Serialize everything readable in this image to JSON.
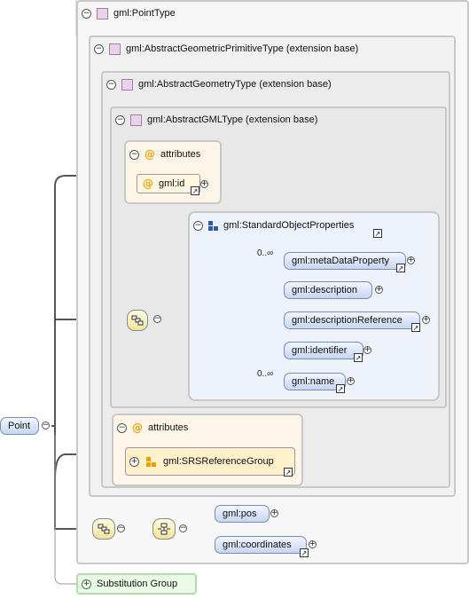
{
  "point": {
    "label": "Point"
  },
  "types": {
    "point_type": "gml:PointType",
    "abstract_geometric_primitive": "gml:AbstractGeometricPrimitiveType (extension base)",
    "abstract_geometry": "gml:AbstractGeometryType (extension base)",
    "abstract_gml": "gml:AbstractGMLType (extension base)"
  },
  "attributes_inner": {
    "label": "attributes",
    "items": [
      "gml:id"
    ]
  },
  "standard_object_properties": {
    "label": "gml:StandardObjectProperties",
    "elements": [
      {
        "name": "gml:metaDataProperty",
        "occurs": "0..∞"
      },
      {
        "name": "gml:description",
        "occurs": ""
      },
      {
        "name": "gml:descriptionReference",
        "occurs": ""
      },
      {
        "name": "gml:identifier",
        "occurs": ""
      },
      {
        "name": "gml:name",
        "occurs": "0..∞"
      }
    ]
  },
  "attributes_outer": {
    "label": "attributes",
    "items": [
      "gml:SRSReferenceGroup"
    ]
  },
  "choice": {
    "items": [
      "gml:pos",
      "gml:coordinates"
    ]
  },
  "substitution": {
    "label": "Substitution Group"
  },
  "colors": {
    "element_fill": "#c6d6f0",
    "attribute_fill": "#fdf6e8",
    "type_border": "#c8c8c8"
  }
}
